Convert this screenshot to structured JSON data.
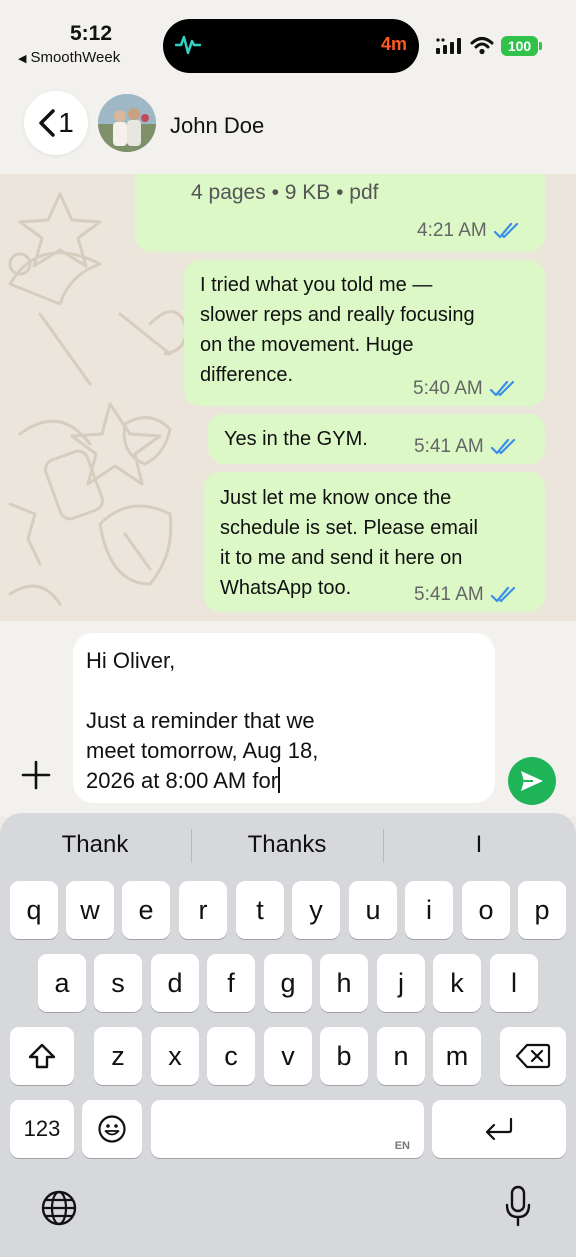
{
  "status": {
    "time": "5:12",
    "back_app": "SmoothWeek",
    "island_timer": "4m",
    "battery": "100",
    "accent_battery": "#30c24b",
    "accent_timer": "#ff5a1f"
  },
  "header": {
    "back_count": "1",
    "contact_name": "John Doe"
  },
  "messages": [
    {
      "text": "4 pages • 9 KB • pdf",
      "time": "4:21 AM",
      "status": "read"
    },
    {
      "text": "I tried what you told me —\nslower reps and really focusing\non the movement. Huge\ndifference.",
      "time": "5:40 AM",
      "status": "read"
    },
    {
      "text": "Yes in the GYM.",
      "time": "5:41 AM",
      "status": "read"
    },
    {
      "text": "Just let me know once the\nschedule is set. Please email\nit to me and send it here on\nWhatsApp too.",
      "time": "5:41 AM",
      "status": "read"
    }
  ],
  "composer": {
    "text": "Hi Oliver,\n\nJust a reminder that we\nmeet tomorrow, Aug 18,\n2026 at 8:00 AM for"
  },
  "keyboard": {
    "suggestions": [
      "Thank",
      "Thanks",
      "I"
    ],
    "row1": [
      "q",
      "w",
      "e",
      "r",
      "t",
      "y",
      "u",
      "i",
      "o",
      "p"
    ],
    "row2": [
      "a",
      "s",
      "d",
      "f",
      "g",
      "h",
      "j",
      "k",
      "l"
    ],
    "row3": [
      "z",
      "x",
      "c",
      "v",
      "b",
      "n",
      "m"
    ],
    "numbers_key": "123",
    "space_lang": "EN"
  },
  "colors": {
    "bubble_out": "#dcf8c6",
    "send": "#1fb458",
    "tick": "#3a8fe6"
  }
}
